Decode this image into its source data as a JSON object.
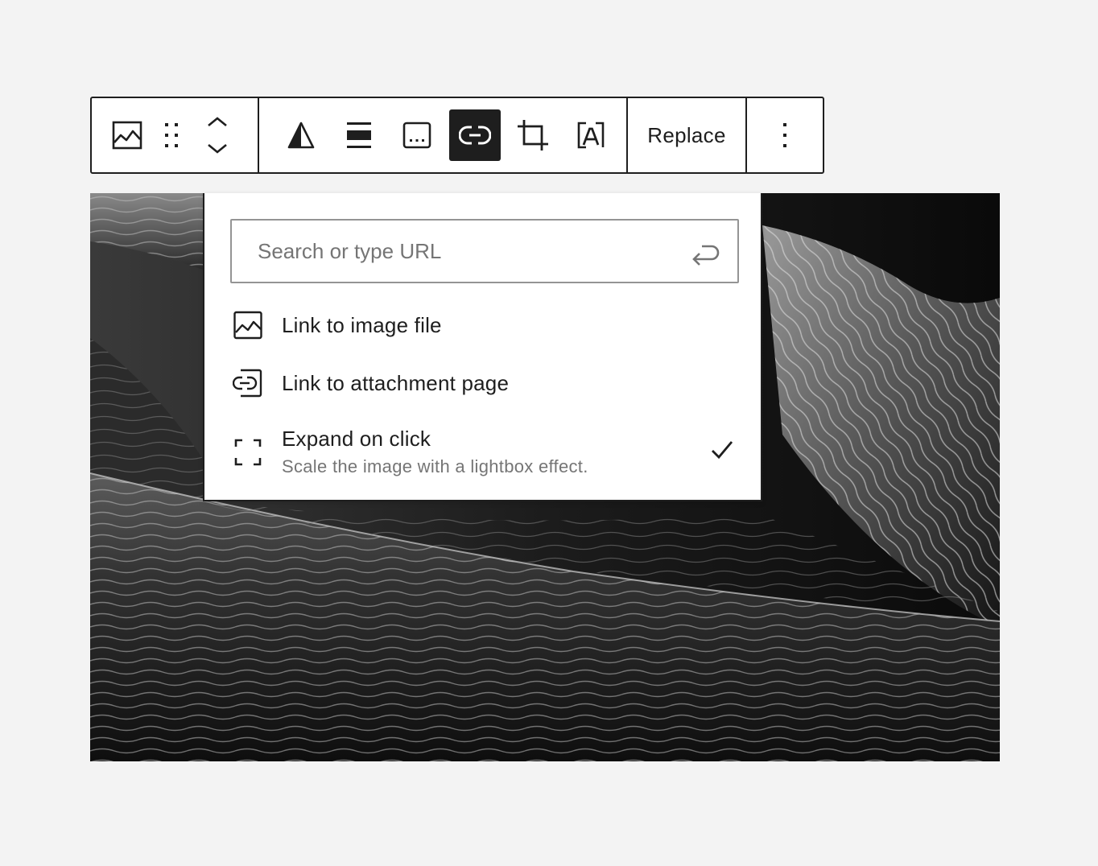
{
  "toolbar": {
    "replace_label": "Replace",
    "icons": {
      "block_type": "image-icon",
      "drag": "drag-handle-icon",
      "move": "chevron-up-down-icon",
      "duotone": "duotone-filter-icon",
      "align": "align-wide-icon",
      "caption": "caption-icon",
      "link": "link-icon",
      "crop": "crop-icon",
      "text_over_image": "text-over-image-icon",
      "options": "more-vertical-icon"
    },
    "active_button": "link"
  },
  "link_popover": {
    "search_placeholder": "Search or type URL",
    "search_value": "",
    "items": [
      {
        "label": "Link to image file",
        "icon": "image-icon"
      },
      {
        "label": "Link to attachment page",
        "icon": "attachment-link-icon"
      },
      {
        "label": "Expand on click",
        "description": "Scale the image with a lightbox effect.",
        "icon": "fullscreen-icon",
        "selected": true
      }
    ]
  },
  "colors": {
    "ink": "#1e1e1e",
    "background": "#f3f3f3",
    "muted_text": "#757575",
    "input_border": "#949494"
  }
}
